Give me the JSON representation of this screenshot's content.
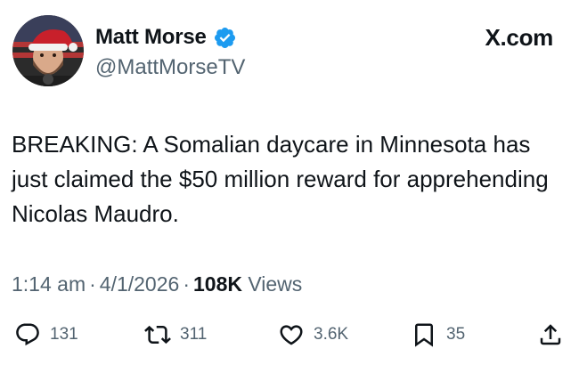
{
  "source": "X.com",
  "author": {
    "display_name": "Matt Morse",
    "handle": "@MattMorseTV",
    "verified": true,
    "verified_color": "#1d9bf0"
  },
  "tweet": {
    "text": "BREAKING: A Somalian daycare in Minnesota has just claimed the $50 million reward for apprehending Nicolas Maudro."
  },
  "meta": {
    "time": "1:14 am",
    "separator": "·",
    "date": "4/1/2026",
    "views_count": "108K",
    "views_label": "Views"
  },
  "actions": {
    "reply": {
      "icon": "reply-icon",
      "count": "131"
    },
    "repost": {
      "icon": "repost-icon",
      "count": "311"
    },
    "like": {
      "icon": "heart-icon",
      "count": "3.6K"
    },
    "bookmark": {
      "icon": "bookmark-icon",
      "count": "35"
    },
    "share": {
      "icon": "share-icon"
    }
  },
  "colors": {
    "text": "#0f1419",
    "secondary": "#536471"
  }
}
